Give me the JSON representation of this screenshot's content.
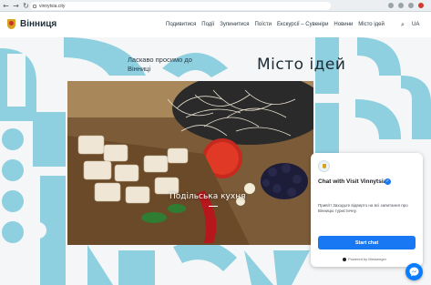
{
  "browser": {
    "url": "vinnytsia.city",
    "back_symbol": "←",
    "forward_symbol": "→",
    "reload_symbol": "↻"
  },
  "header": {
    "logo_text": "Вінниця",
    "nav": [
      "Подивитися",
      "Події",
      "Зупинитися",
      "Поїсти",
      "Екскурсії – Сувеніри",
      "Новини",
      "Місто ідей"
    ],
    "search_symbol": "⌕",
    "lang_label": "UA"
  },
  "hero": {
    "welcome": "Ласкаво просимо до Вінниці",
    "city_title": "Місто ідей",
    "slide_caption": "Подільська кухня"
  },
  "chat": {
    "title": "Chat with Visit Vinnytsia",
    "message": "Привіт! Заходьте відверто на всі запитання про Вінницю туристичну.",
    "start_button": "Start chat",
    "powered_by": "Powered by Messenger"
  },
  "colors": {
    "accent_blue": "#8ecfe0",
    "messenger_blue": "#1877f2",
    "logo_gold": "#d8a21c"
  }
}
